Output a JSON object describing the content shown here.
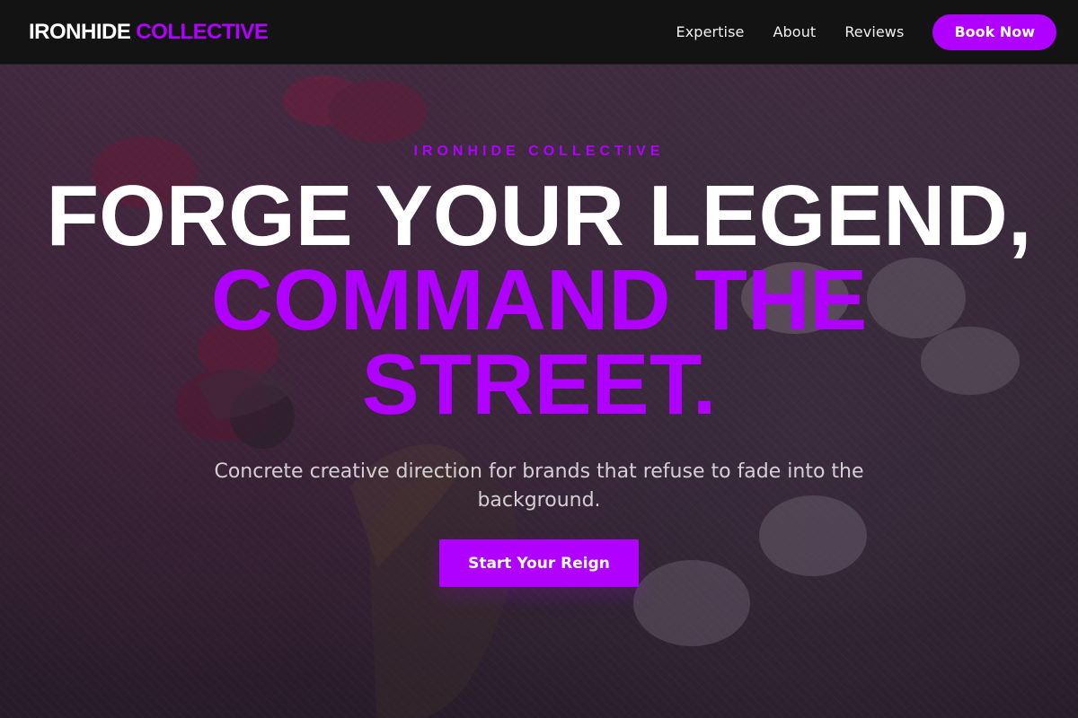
{
  "header": {
    "brand_primary": "IRONHIDE",
    "brand_secondary": "COLLECTIVE",
    "nav": [
      "Expertise",
      "About",
      "Reviews"
    ],
    "book_label": "Book Now"
  },
  "hero": {
    "eyebrow": "IRONHIDE COLLECTIVE",
    "headline_line1": "FORGE YOUR LEGEND,",
    "headline_line2": "COMMAND THE",
    "headline_line3": "STREET.",
    "subtitle": "Concrete creative direction for brands that refuse to fade into the background.",
    "cta_label": "Start Your Reign"
  },
  "colors": {
    "accent": "#b000ff",
    "header_bg": "#141314",
    "hero_bg": "#2d222e"
  }
}
